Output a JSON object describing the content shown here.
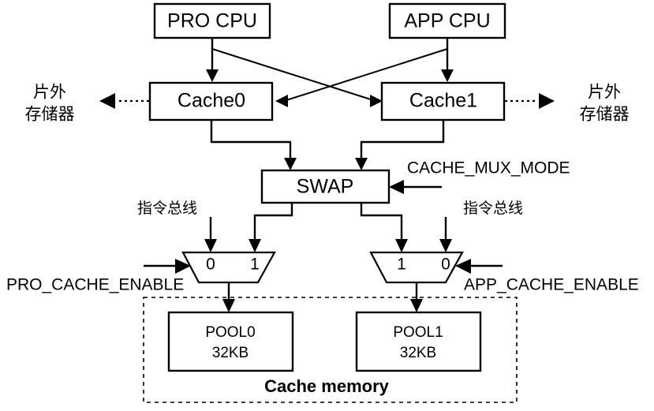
{
  "diagram": {
    "title_label": "Cache memory",
    "cpus": [
      {
        "id": "pro-cpu",
        "label": "PRO CPU"
      },
      {
        "id": "app-cpu",
        "label": "APP CPU"
      }
    ],
    "caches": [
      {
        "id": "cache0",
        "label": "Cache0"
      },
      {
        "id": "cache1",
        "label": "Cache1"
      }
    ],
    "external_memory": [
      {
        "id": "ext-mem-left",
        "line1": "片外",
        "line2": "存储器"
      },
      {
        "id": "ext-mem-right",
        "line1": "片外",
        "line2": "存储器"
      }
    ],
    "swap": {
      "label": "SWAP"
    },
    "signals": {
      "cache_mux_mode": "CACHE_MUX_MODE",
      "pro_cache_enable": "PRO_CACHE_ENABLE",
      "app_cache_enable": "APP_CACHE_ENABLE"
    },
    "instruction_bus": [
      {
        "id": "inst-bus-left",
        "label": "指令总线"
      },
      {
        "id": "inst-bus-right",
        "label": "指令总线"
      }
    ],
    "muxes": [
      {
        "id": "mux-left",
        "input_labels": [
          "0",
          "1"
        ]
      },
      {
        "id": "mux-right",
        "input_labels": [
          "1",
          "0"
        ]
      }
    ],
    "pools": [
      {
        "id": "pool0",
        "name": "POOL0",
        "size": "32KB"
      },
      {
        "id": "pool1",
        "name": "POOL1",
        "size": "32KB"
      }
    ],
    "colors": {
      "stroke": "#000000",
      "fill": "#ffffff",
      "background": "#ffffff"
    }
  }
}
